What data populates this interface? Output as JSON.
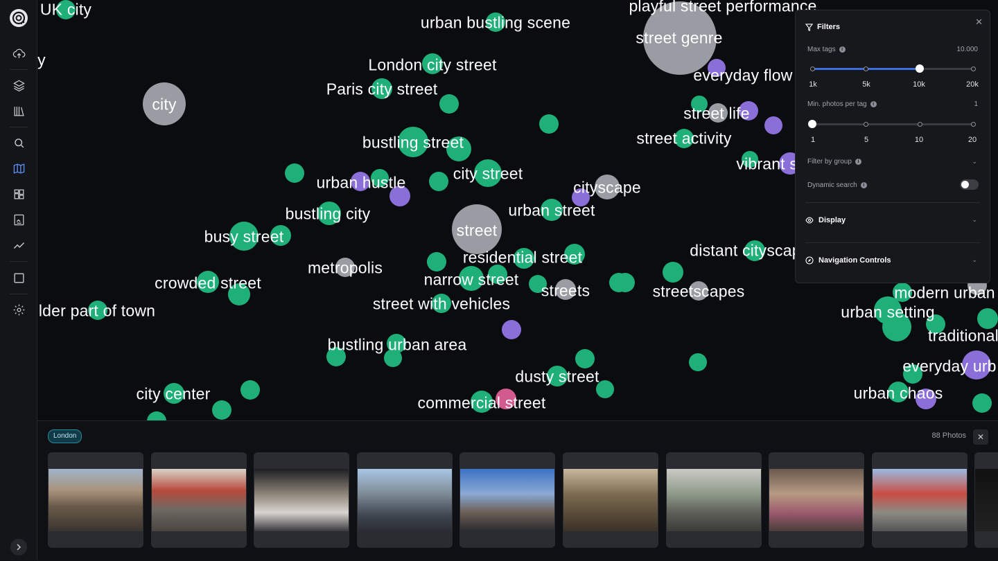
{
  "sidebar": {
    "items": [
      {
        "icon": "upload-cloud-icon"
      },
      {
        "icon": "layers-icon"
      },
      {
        "icon": "library-icon"
      },
      {
        "icon": "search-icon"
      },
      {
        "icon": "map-icon",
        "active": true
      },
      {
        "icon": "grid-icon"
      },
      {
        "icon": "image-board-icon"
      },
      {
        "icon": "trend-icon"
      },
      {
        "icon": "square-icon"
      },
      {
        "icon": "gear-icon"
      }
    ],
    "expand_icon": "chevron-right-icon"
  },
  "map": {
    "colors": {
      "grey": "#9a9ca3",
      "green": "#1fb07a",
      "purple": "#8b6fd9",
      "pink": "#d35a8e"
    },
    "tags": [
      "UK city",
      "ity",
      "urban bustling scene",
      "playful street performance",
      "street genre",
      "London city street",
      "everyday flow",
      "Paris city street",
      "city",
      "street life",
      "street activity",
      "bustling street",
      "vibrant st",
      "city street",
      "urban hustle",
      "cityscape",
      "bustling city",
      "urban street",
      "street",
      "busy street",
      "distant cityscape",
      "residential street",
      "metropolis",
      "narrow street",
      "crowded street",
      "streets",
      "streetscapes",
      "modern urban",
      "street with vehicles",
      "lder part of town",
      "urban setting",
      "traditional",
      "bustling urban area",
      "everyday urb",
      "dusty street",
      "city center",
      "urban chaos",
      "commercial street"
    ]
  },
  "filters": {
    "title": "Filters",
    "max_tags_label": "Max tags",
    "max_tags_value": "10.000",
    "max_tags_ticks": [
      "1k",
      "5k",
      "10k",
      "20k"
    ],
    "max_tags_selected_fraction": 0.67,
    "min_photos_label": "Min. photos per tag",
    "min_photos_value": "1",
    "min_photos_ticks": [
      "1",
      "5",
      "10",
      "20"
    ],
    "min_photos_selected_fraction": 0,
    "group_label": "Filter by group",
    "dynamic_label": "Dynamic search",
    "dynamic_on": false,
    "display_label": "Display",
    "nav_label": "Navigation Controls"
  },
  "strip": {
    "chip": "London",
    "count": "88 Photos",
    "photos": [
      {
        "desc": "street-crowd-photo"
      },
      {
        "desc": "red-bus-street-photo"
      },
      {
        "desc": "pedestrian-portrait-photo"
      },
      {
        "desc": "business-street-photo"
      },
      {
        "desc": "street-sign-sky-photo"
      },
      {
        "desc": "woman-portrait-photo"
      },
      {
        "desc": "tube-carriage-photo"
      },
      {
        "desc": "children-street-photo"
      },
      {
        "desc": "red-bus-square-photo"
      },
      {
        "desc": "partial-photo"
      }
    ]
  }
}
